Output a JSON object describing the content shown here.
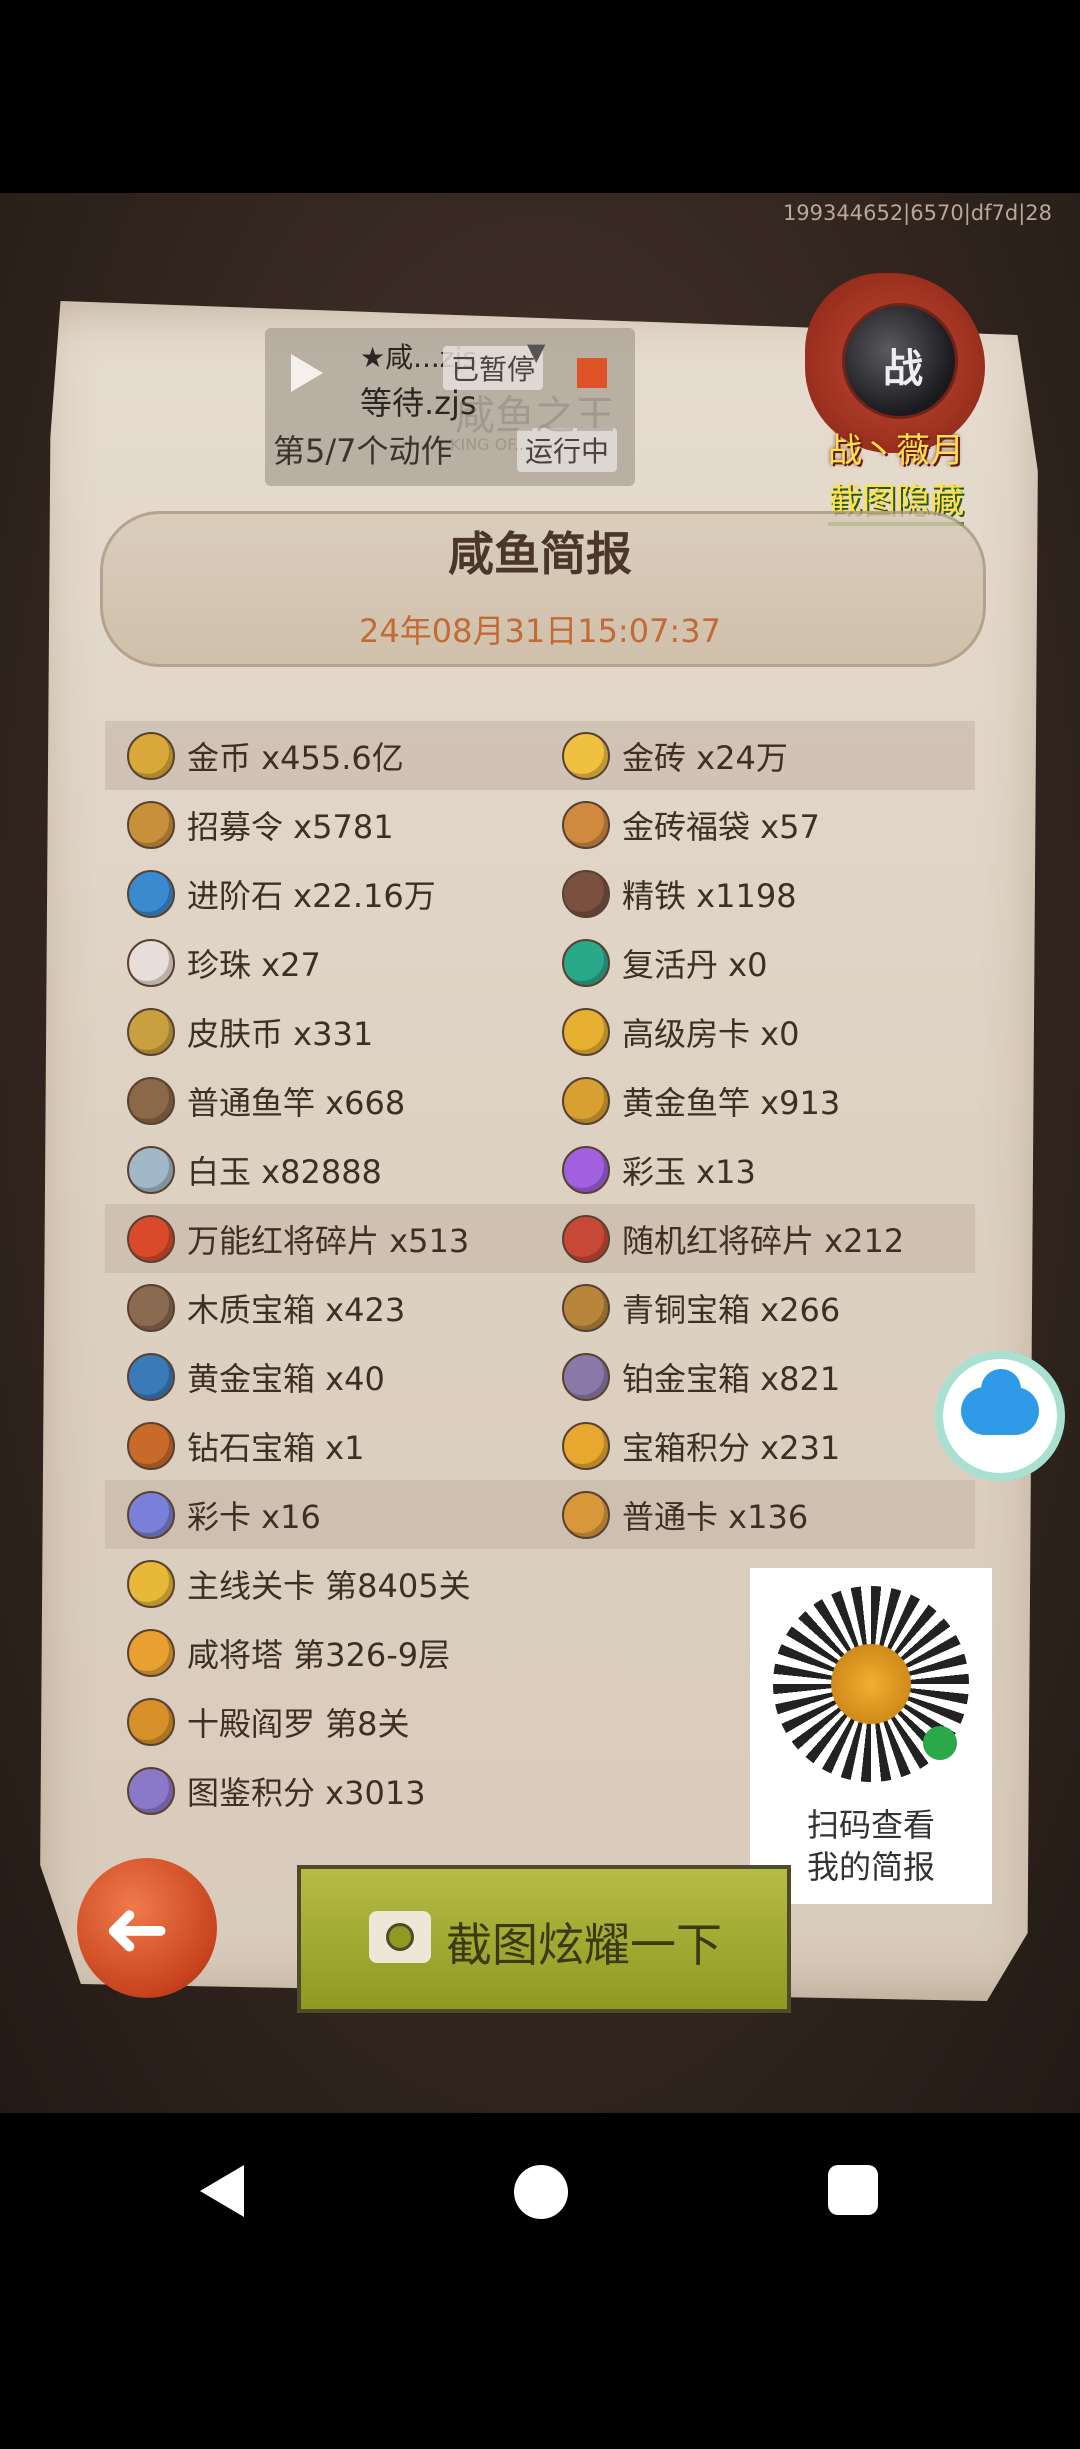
{
  "device_id": "199344652|6570|df7d|28",
  "control": {
    "line1": "★咸...zjs",
    "paused_label": "已暂停",
    "line2": "等待.zjs",
    "step": "第5/7个动作",
    "running_label": "运行中"
  },
  "watermark": {
    "cn": "咸鱼之王",
    "en": "KING OF..."
  },
  "seal": {
    "avatar_char": "战",
    "name": "战丶薇月",
    "hide_label": "截图隐藏"
  },
  "title": "咸鱼简报",
  "date": "24年08月31日15:07:37",
  "rows": [
    {
      "hl": true,
      "l": {
        "text": "金币 x455.6亿",
        "icon": "coin-icon",
        "color": "#d9a83a"
      },
      "r": {
        "text": "金砖 x24万",
        "icon": "gold-brick-icon",
        "color": "#f0c040"
      }
    },
    {
      "hl": false,
      "l": {
        "text": "招募令 x5781",
        "icon": "recruit-order-icon",
        "color": "#c8903a"
      },
      "r": {
        "text": "金砖福袋 x57",
        "icon": "gold-bag-icon",
        "color": "#d08a40"
      }
    },
    {
      "hl": false,
      "l": {
        "text": "进阶石 x22.16万",
        "icon": "advance-stone-icon",
        "color": "#3a8ad0"
      },
      "r": {
        "text": "精铁 x1198",
        "icon": "iron-icon",
        "color": "#7a5040"
      }
    },
    {
      "hl": false,
      "l": {
        "text": "珍珠 x27",
        "icon": "pearl-icon",
        "color": "#e8ddd8"
      },
      "r": {
        "text": "复活丹 x0",
        "icon": "revive-pill-icon",
        "color": "#2aa88a"
      }
    },
    {
      "hl": false,
      "l": {
        "text": "皮肤币 x331",
        "icon": "skin-coin-icon",
        "color": "#c8a040"
      },
      "r": {
        "text": "高级房卡 x0",
        "icon": "room-card-icon",
        "color": "#e8b030"
      }
    },
    {
      "hl": false,
      "l": {
        "text": "普通鱼竿 x668",
        "icon": "fishing-rod-icon",
        "color": "#8a6848"
      },
      "r": {
        "text": "黄金鱼竿 x913",
        "icon": "gold-rod-icon",
        "color": "#d8a030"
      }
    },
    {
      "hl": false,
      "l": {
        "text": "白玉 x82888",
        "icon": "white-jade-icon",
        "color": "#a0b8c8"
      },
      "r": {
        "text": "彩玉 x13",
        "icon": "color-jade-icon",
        "color": "#a060e0"
      }
    },
    {
      "hl": true,
      "l": {
        "text": "万能红将碎片 x513",
        "icon": "red-shard-icon",
        "color": "#d84a2a"
      },
      "r": {
        "text": "随机红将碎片 x212",
        "icon": "random-shard-icon",
        "color": "#c84838"
      }
    },
    {
      "hl": false,
      "l": {
        "text": "木质宝箱 x423",
        "icon": "wood-chest-icon",
        "color": "#8a6a50"
      },
      "r": {
        "text": "青铜宝箱 x266",
        "icon": "bronze-chest-icon",
        "color": "#b8863a"
      }
    },
    {
      "hl": false,
      "l": {
        "text": "黄金宝箱 x40",
        "icon": "gold-chest-icon",
        "color": "#3a7ab8"
      },
      "r": {
        "text": "铂金宝箱 x821",
        "icon": "platinum-chest-icon",
        "color": "#8a78a8"
      }
    },
    {
      "hl": false,
      "l": {
        "text": "钻石宝箱 x1",
        "icon": "diamond-chest-icon",
        "color": "#c86a2a"
      },
      "r": {
        "text": "宝箱积分 x231",
        "icon": "chest-points-icon",
        "color": "#e8a830"
      }
    },
    {
      "hl": true,
      "l": {
        "text": "彩卡 x16",
        "icon": "color-card-icon",
        "color": "#7a80d8"
      },
      "r": {
        "text": "普通卡 x136",
        "icon": "normal-card-icon",
        "color": "#d8983a"
      }
    },
    {
      "hl": false,
      "l": {
        "text": "主线关卡 第8405关",
        "icon": "main-stage-icon",
        "color": "#e8b838"
      },
      "r": null
    },
    {
      "hl": false,
      "l": {
        "text": "咸将塔 第326-9层",
        "icon": "tower-icon",
        "color": "#e8a030"
      },
      "r": null
    },
    {
      "hl": false,
      "l": {
        "text": "十殿阎罗 第8关",
        "icon": "yama-icon",
        "color": "#d8902a"
      },
      "r": null
    },
    {
      "hl": false,
      "l": {
        "text": "图鉴积分 x3013",
        "icon": "codex-points-icon",
        "color": "#8a78c8"
      },
      "r": null
    }
  ],
  "qr": {
    "line1": "扫码查看",
    "line2": "我的简报"
  },
  "screenshot_button": "截图炫耀一下",
  "back_arrow": "➜"
}
